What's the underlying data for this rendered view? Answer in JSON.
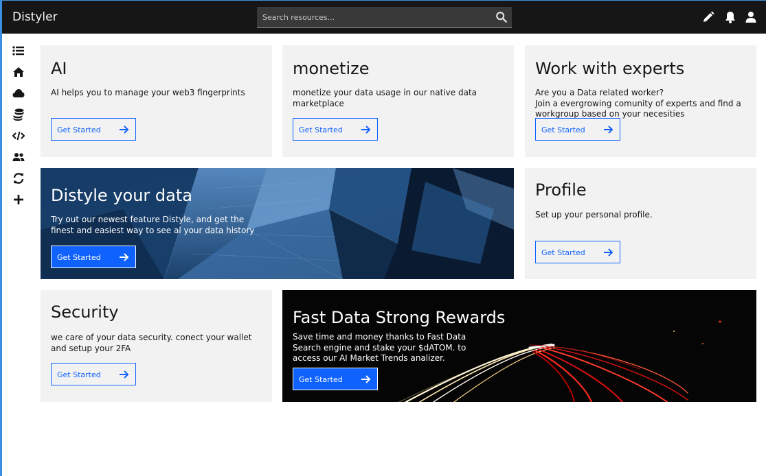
{
  "app": {
    "title": "Distyler"
  },
  "search": {
    "placeholder": "Search resources..."
  },
  "header_icons": [
    "edit-icon",
    "notification-icon",
    "user-icon"
  ],
  "sidebar": {
    "items": [
      "list-icon",
      "home-icon",
      "cloud-icon",
      "database-icon",
      "code-icon",
      "users-icon",
      "refresh-icon",
      "add-icon"
    ]
  },
  "tiles": {
    "ai": {
      "title": "AI",
      "text": "AI helps you to manage your web3 fingerprints",
      "button": "Get Started"
    },
    "monetize": {
      "title": "monetize",
      "text": "monetize your data usage in our native data marketplace",
      "button": "Get Started"
    },
    "experts": {
      "title": "Work with experts",
      "text": "Are you a Data related worker?\nJoin a evergrowing comunity of experts and find a workgroup based on your necesities",
      "button": "Get Started"
    },
    "distyle": {
      "title": "Distyle your data",
      "text": "Try out our newest feature Distyle, and get the finest and easiest way to see al your data history",
      "button": "Get Started"
    },
    "profile": {
      "title": "Profile",
      "text": "Set up your personal profile.",
      "button": "Get Started"
    },
    "security": {
      "title": "Security",
      "text": "we care of your data security. conect your wallet and setup your 2FA",
      "button": "Get Started"
    },
    "rewards": {
      "title": "Fast Data Strong Rewards",
      "text": "Save time and money thanks to Fast Data Search engine and stake your $dATOM. to access our AI Market Trends analizer.",
      "button": "Get Started"
    }
  },
  "colors": {
    "accent": "#0f62fe",
    "header": "#161616",
    "tile": "#f2f2f2"
  }
}
